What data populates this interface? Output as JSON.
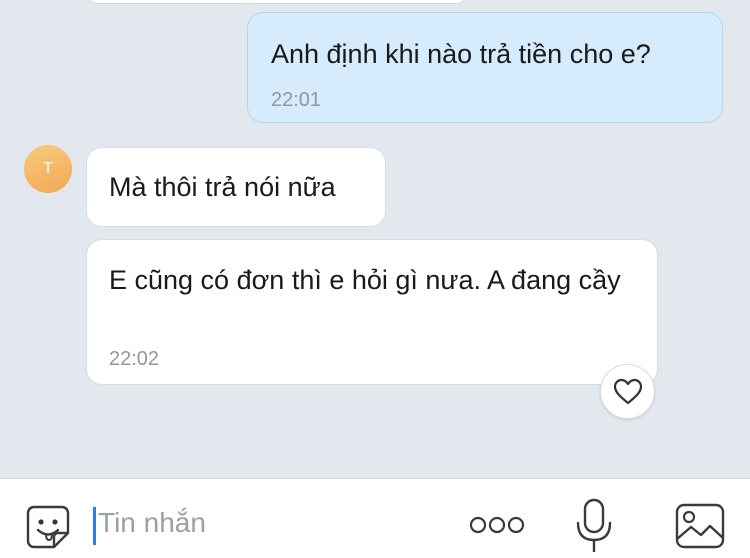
{
  "conversation": {
    "messages": [
      {
        "sender": "me",
        "text": "Anh định khi nào trả tiền cho e?",
        "time": "22:01"
      },
      {
        "sender": "them",
        "text": "Mà thôi trả nói nữa",
        "time": ""
      },
      {
        "sender": "them",
        "text": "E cũng có đơn thì e hỏi gì nưa. A đang cầy",
        "time": "22:02"
      }
    ],
    "contact_avatar_initial": "T"
  },
  "composer": {
    "placeholder": "Tin nhắn",
    "value": ""
  },
  "icons": {
    "sticker": "sticker-smiley-icon",
    "more": "more-dots-icon",
    "mic": "microphone-icon",
    "image": "image-gallery-icon",
    "reaction": "heart-icon"
  },
  "colors": {
    "my_bubble": "#d6ebfb",
    "their_bubble": "#ffffff",
    "chat_background": "#e3e7ee",
    "avatar": "#f1a957",
    "caret": "#2f7fe8"
  }
}
